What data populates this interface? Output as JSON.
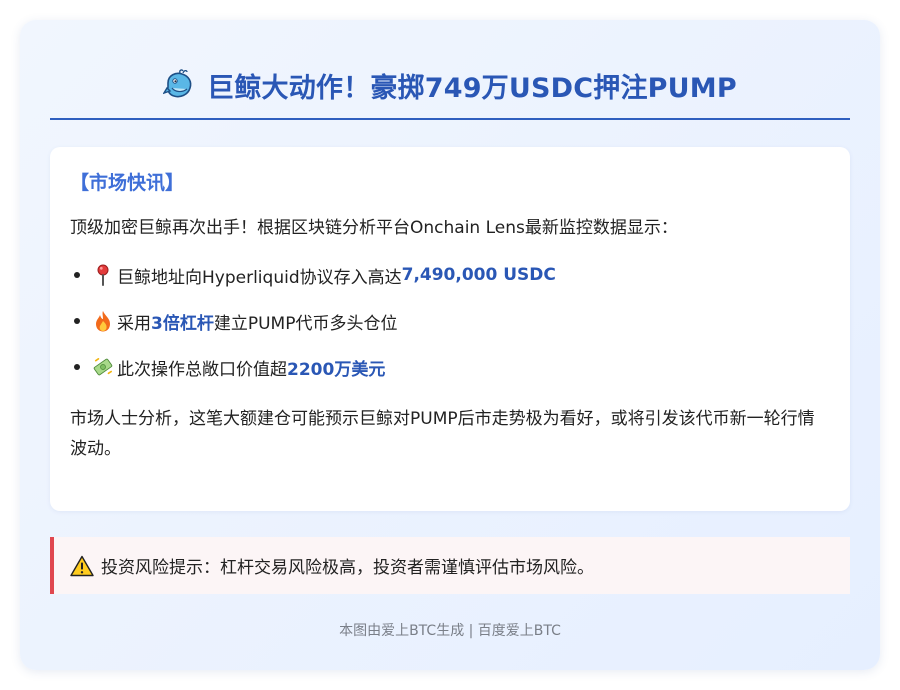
{
  "title": {
    "text": "巨鲸大动作！豪掷749万USDC押注PUMP",
    "icon": "whale-icon"
  },
  "news": {
    "heading": "【市场快讯】",
    "intro": "顶级加密巨鲸再次出手！根据区块链分析平台Onchain Lens最新监控数据显示：",
    "bullets": [
      {
        "icon": "pin-icon",
        "pre": "巨鲸地址向Hyperliquid协议存入高达",
        "highlight": "7,490,000 USDC",
        "post": ""
      },
      {
        "icon": "fire-icon",
        "pre": "采用",
        "highlight": "3倍杠杆",
        "post": "建立PUMP代币多头仓位"
      },
      {
        "icon": "money-icon",
        "pre": "此次操作总敞口价值超",
        "highlight": "2200万美元",
        "post": ""
      }
    ],
    "analysis": "市场人士分析，这笔大额建仓可能预示巨鲸对PUMP后市走势极为看好，或将引发该代币新一轮行情波动。"
  },
  "risk": {
    "icon": "warning-icon",
    "text": "投资风险提示：杠杆交易风险极高，投资者需谨慎评估市场风险。"
  },
  "footer": {
    "text": "本图由爱上BTC生成 | 百度爱上BTC"
  },
  "colors": {
    "accent": "#2a57b5",
    "heading": "#3f6fd8",
    "risk_border": "#e0474f",
    "background": "#e6efff"
  }
}
